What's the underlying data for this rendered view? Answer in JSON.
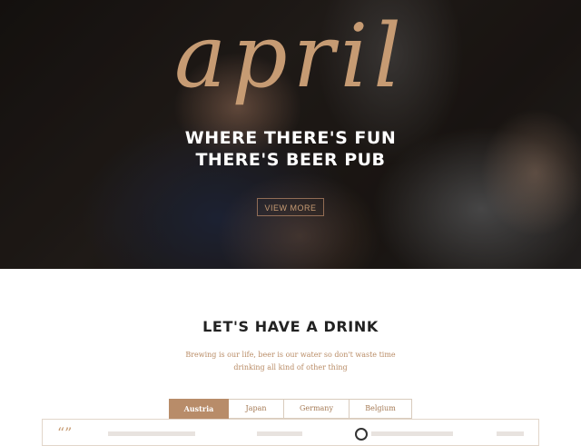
{
  "hero": {
    "script": "april",
    "title_line1": "WHERE THERE'S FUN",
    "title_line2": "THERE'S BEER PUB",
    "button_label": "VIEW MORE"
  },
  "section": {
    "title": "LET'S HAVE A DRINK",
    "description": "Brewing is our life, beer is our water so don't waste time drinking all kind of other thing"
  },
  "tabs": [
    {
      "label": "Austria",
      "active": true
    },
    {
      "label": "Japan",
      "active": false
    },
    {
      "label": "Germany",
      "active": false
    },
    {
      "label": "Belgium",
      "active": false
    }
  ],
  "colors": {
    "accent": "#b88c69",
    "script": "#c69b73",
    "heading": "#222222"
  }
}
